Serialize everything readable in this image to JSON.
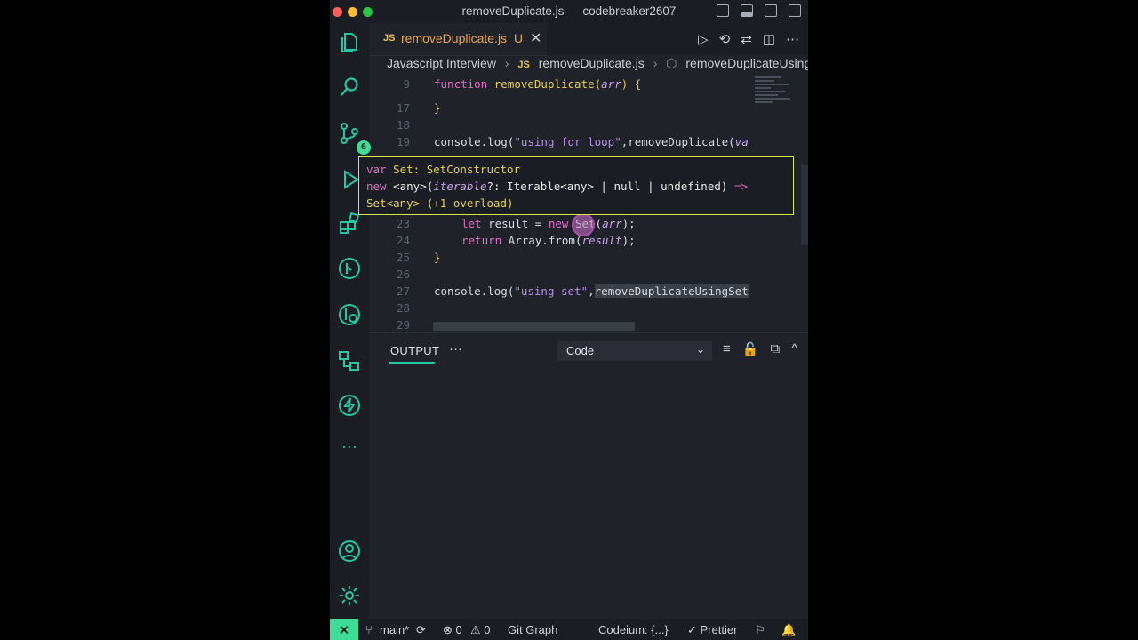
{
  "window": {
    "title": "removeDuplicate.js — codebreaker2607"
  },
  "tab": {
    "lang": "JS",
    "name": "removeDuplicate.js",
    "modified": "U",
    "close": "✕"
  },
  "editor_actions": [
    "▷",
    "⟲",
    "⇄",
    "◫",
    "⋯"
  ],
  "breadcrumb": {
    "folder": "Javascript Interview",
    "lang": "JS",
    "file": "removeDuplicate.js",
    "symbol": "removeDuplicateUsingSet"
  },
  "activity": {
    "scm_badge": "6"
  },
  "code": {
    "lines": [
      {
        "n": "9",
        "text": ""
      },
      {
        "n": "17",
        "text": ""
      },
      {
        "n": "18",
        "text": ""
      },
      {
        "n": "19",
        "text": ""
      },
      {
        "n": "23",
        "text": ""
      },
      {
        "n": "24",
        "text": ""
      },
      {
        "n": "25",
        "text": ""
      },
      {
        "n": "26",
        "text": ""
      },
      {
        "n": "27",
        "text": ""
      },
      {
        "n": "28",
        "text": ""
      },
      {
        "n": "29",
        "text": ""
      }
    ],
    "t_function": "function",
    "t_fname": "removeDuplicate",
    "t_arr": "arr",
    "t_open": "(",
    "t_close_brace": ") {",
    "t_rb": "}",
    "t_console1": "console.log(",
    "t_str1": "\"using for loop\"",
    "t_call1": ",removeDuplicate(",
    "t_va": "va",
    "t_let": "let",
    "t_result_new": " result = ",
    "t_new": "new",
    "t_set": " Set(",
    "t_arr2": "arr",
    "t_end1": ");",
    "t_return": "return",
    "t_array_from": " Array.from(",
    "t_result": "result",
    "t_end2": ");",
    "t_console2": "console.log(",
    "t_str2": "\"using set\"",
    "t_comma": ",",
    "t_call2": "removeDuplicateUsingSet"
  },
  "hover": {
    "line1_kw": "var",
    "line1": " Set: SetConstructor",
    "line2_kw": "new",
    "line2a": " <any>(",
    "line2_param": "iterable",
    "line2b": "?: Iterable<any> | null | undefined) ",
    "line2_arrow": "=>",
    "line3": "Set<any> (+1 overload)"
  },
  "panel": {
    "tab": "OUTPUT",
    "more": "···",
    "channel": "Code",
    "chevron": "⌄",
    "actions": [
      "≡",
      "🔓",
      "⧉",
      "^",
      "✕"
    ]
  },
  "status": {
    "branch": "main*",
    "sync": "⟳",
    "errors": "⊗ 0",
    "warnings": "⚠ 0",
    "git_graph": "Git Graph",
    "codeium": "Codeium: {...}",
    "prettier": "✓ Prettier",
    "remote": "⨯"
  }
}
